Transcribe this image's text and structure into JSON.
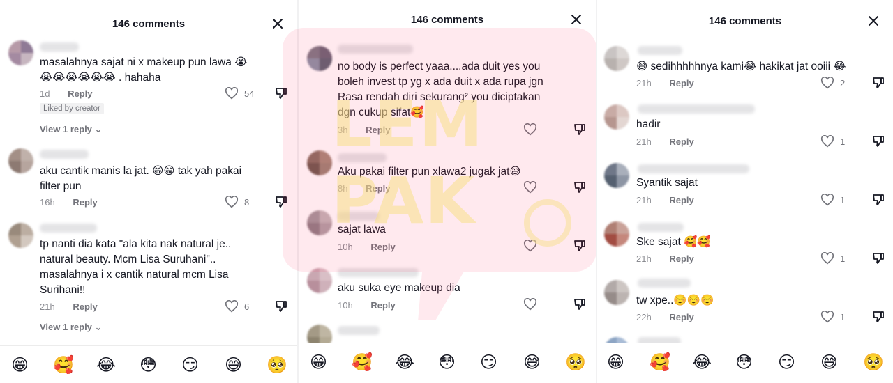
{
  "accent": "#fe2c55",
  "panels": [
    {
      "title": "146 comments",
      "comments": [
        {
          "text_lines": [
            "masalahnya sajat ni x makeup pun lawa 😭",
            "😭😭😭😭😭😭 . hahaha"
          ],
          "time": "1d",
          "reply": "Reply",
          "likes": "54",
          "badge": "Liked by creator",
          "view_replies": "View 1 reply"
        },
        {
          "text_lines": [
            "aku cantik manis la jat. 😁😁 tak yah pakai",
            "filter pun"
          ],
          "time": "16h",
          "reply": "Reply",
          "likes": "8"
        },
        {
          "text_lines": [
            "tp nanti dia kata \"ala kita nak natural je..",
            "natural beauty. Mcm Lisa Suruhani\"..",
            "masalahnya i x cantik natural mcm Lisa",
            "Surihani!!"
          ],
          "time": "21h",
          "reply": "Reply",
          "likes": "6",
          "view_replies": "View 1 reply"
        }
      ],
      "emojis": [
        "😁",
        "🥰",
        "😂",
        "😳",
        "😏",
        "😅",
        "🥺"
      ]
    },
    {
      "title": "146 comments",
      "comments": [
        {
          "text_lines": [
            "no body is perfect yaaa....ada duit yes you",
            "boleh invest tp yg x ada duit x ada rupa jgn",
            "Rasa rendah diri sekurang² you diciptakan",
            "dgn cukup sifat🥰"
          ],
          "time": "3h",
          "reply": "Reply",
          "likes": ""
        },
        {
          "text_lines": [
            "Aku pakai filter pun xlawa2 jugak jat😅"
          ],
          "time": "8h",
          "reply": "Reply",
          "likes": ""
        },
        {
          "text_lines": [
            "sajat lawa"
          ],
          "time": "10h",
          "reply": "Reply",
          "likes": ""
        },
        {
          "text_lines": [
            "aku suka eye makeup dia"
          ],
          "time": "10h",
          "reply": "Reply",
          "likes": ""
        }
      ],
      "emojis": [
        "😁",
        "🥰",
        "😂",
        "😳",
        "😏",
        "😅",
        "🥺"
      ]
    },
    {
      "title": "146 comments",
      "comments": [
        {
          "text_lines": [
            "😅 sedihhhhhnya kami😂 hakikat jat ooiii 😂"
          ],
          "time": "21h",
          "reply": "Reply",
          "likes": "2"
        },
        {
          "text_lines": [
            "hadir"
          ],
          "time": "21h",
          "reply": "Reply",
          "likes": "1"
        },
        {
          "text_lines": [
            "Syantik sajat"
          ],
          "time": "21h",
          "reply": "Reply",
          "likes": "1"
        },
        {
          "text_lines": [
            "Ske sajat 🥰🥰"
          ],
          "time": "21h",
          "reply": "Reply",
          "likes": "1"
        },
        {
          "text_lines": [
            "tw xpe..☺️☺️☺️"
          ],
          "time": "22h",
          "reply": "Reply",
          "likes": "1"
        }
      ],
      "emojis": [
        "😁",
        "🥰",
        "😂",
        "😳",
        "😏",
        "😅",
        "🥺"
      ]
    }
  ],
  "icons": {
    "close": "close-icon",
    "like": "heart-outline-icon",
    "dislike": "thumbs-down-icon",
    "chevron": "chevron-down-icon"
  }
}
